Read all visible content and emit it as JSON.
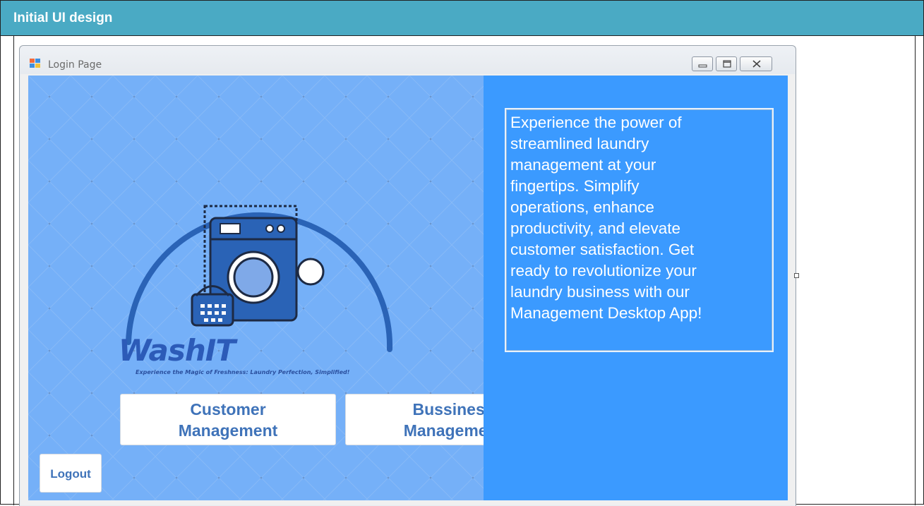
{
  "document": {
    "header_title": "Initial UI design"
  },
  "window": {
    "title": "Login Page",
    "controls": [
      "minimize",
      "maximize",
      "close"
    ]
  },
  "brand": {
    "name": "WashIT",
    "tagline": "Experience the Magic of Freshness: Laundry Perfection, Simplified!"
  },
  "description": "Experience the power of\nstreamlined laundry\nmanagement at your\nfingertips. Simplify\noperations, enhance\nproductivity, and elevate\ncustomer satisfaction. Get\nready to revolutionize your\nlaundry business with our\nManagement Desktop App!",
  "buttons": {
    "customer": "Customer\nManagement",
    "business": "Bussiness\nManagement",
    "logout": "Logout"
  },
  "icons": {
    "app_icon": "windows-form-icon",
    "logo_icon": "washing-machine-icon"
  },
  "colors": {
    "header": "#4aaac4",
    "left_panel": "#75b0f8",
    "right_panel": "#3b9aff",
    "button_text": "#3f73b9",
    "logo_blue": "#2c5bb8"
  }
}
